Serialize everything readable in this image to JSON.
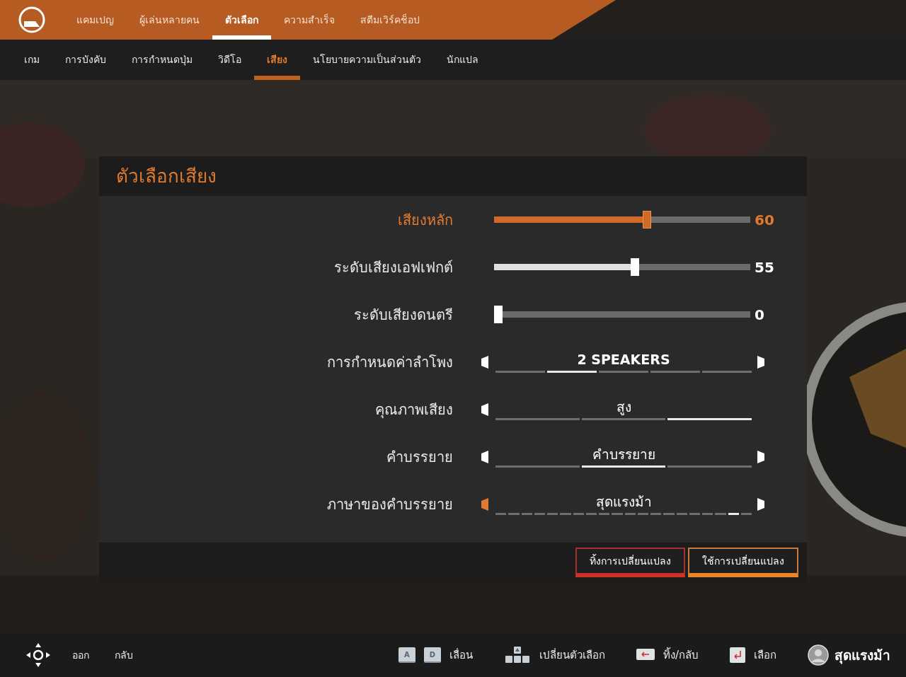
{
  "top_tabs": [
    {
      "label": "แคมเปญ",
      "selected": false
    },
    {
      "label": "ผู้เล่นหลายคน",
      "selected": false
    },
    {
      "label": "ตัวเลือก",
      "selected": true
    },
    {
      "label": "ความสำเร็จ",
      "selected": false
    },
    {
      "label": "สตีมเวิร์คช็อป",
      "selected": false
    }
  ],
  "sub_tabs": [
    {
      "label": "เกม",
      "selected": false
    },
    {
      "label": "การบังคับ",
      "selected": false
    },
    {
      "label": "การกำหนดปุ่ม",
      "selected": false
    },
    {
      "label": "วิดีโอ",
      "selected": false
    },
    {
      "label": "เสียง",
      "selected": true
    },
    {
      "label": "นโยบายความเป็นส่วนตัว",
      "selected": false
    },
    {
      "label": "นักแปล",
      "selected": false
    }
  ],
  "panel": {
    "title": "ตัวเลือกเสียง",
    "rows": [
      {
        "kind": "slider",
        "label": "เสียงหลัก",
        "selected": true,
        "level": 0.6,
        "reading": "60"
      },
      {
        "kind": "slider",
        "label": "ระดับเสียงเอฟเฟกต์",
        "selected": false,
        "level": 0.55,
        "reading": "55"
      },
      {
        "kind": "slider",
        "label": "ระดับเสียงดนตรี",
        "selected": false,
        "level": 0,
        "reading": "0"
      },
      {
        "kind": "choice",
        "label": "การกำหนดค่าลำโพง",
        "selected": false,
        "value": "2 SPEAKERS",
        "bold": true,
        "prev": true,
        "next": true,
        "prev_hover": false,
        "segments": [
          {
            "selected": false
          },
          {
            "selected": true
          },
          {
            "selected": false
          },
          {
            "selected": false
          },
          {
            "selected": false
          }
        ]
      },
      {
        "kind": "choice",
        "label": "คุณภาพเสียง",
        "selected": false,
        "value": "สูง",
        "bold": false,
        "prev": true,
        "next": false,
        "prev_hover": false,
        "segments": [
          {
            "selected": false
          },
          {
            "selected": false
          },
          {
            "selected": true
          }
        ]
      },
      {
        "kind": "choice",
        "label": "คำบรรยาย",
        "selected": false,
        "value": "คำบรรยาย",
        "bold": false,
        "prev": true,
        "next": true,
        "prev_hover": false,
        "segments": [
          {
            "selected": false
          },
          {
            "selected": true
          },
          {
            "selected": false
          }
        ]
      },
      {
        "kind": "choice",
        "label": "ภาษาของคำบรรยาย",
        "selected": false,
        "value": "สุดแรงม้า",
        "bold": false,
        "prev": true,
        "next": true,
        "prev_hover": true,
        "segments": [
          {
            "selected": false
          },
          {
            "selected": false
          },
          {
            "selected": false
          },
          {
            "selected": false
          },
          {
            "selected": false
          },
          {
            "selected": false
          },
          {
            "selected": false
          },
          {
            "selected": false
          },
          {
            "selected": false
          },
          {
            "selected": false
          },
          {
            "selected": false
          },
          {
            "selected": false
          },
          {
            "selected": false
          },
          {
            "selected": false
          },
          {
            "selected": false
          },
          {
            "selected": false
          },
          {
            "selected": false
          },
          {
            "selected": false
          },
          {
            "selected": true
          },
          {
            "selected": false
          }
        ]
      }
    ],
    "buttons": [
      {
        "label": "ทิ้งการเปลี่ยนแปลง",
        "kind": "discard"
      },
      {
        "label": "ใช้การเปลี่ยนแปลง",
        "kind": "apply"
      }
    ]
  },
  "footer": {
    "left": [
      {
        "label": "ออก"
      },
      {
        "label": "กลับ"
      }
    ],
    "hints": [
      {
        "kind": "ad",
        "keys": [
          "A",
          "D"
        ],
        "label": "เลื่อน"
      },
      {
        "kind": "dpad",
        "label": "เปลี่ยนตัวเลือก"
      },
      {
        "kind": "backspace",
        "label": "ทิ้ง/กลับ"
      },
      {
        "kind": "enter",
        "label": "เลือก"
      }
    ],
    "user": {
      "name": "สุดแรงม้า"
    }
  }
}
